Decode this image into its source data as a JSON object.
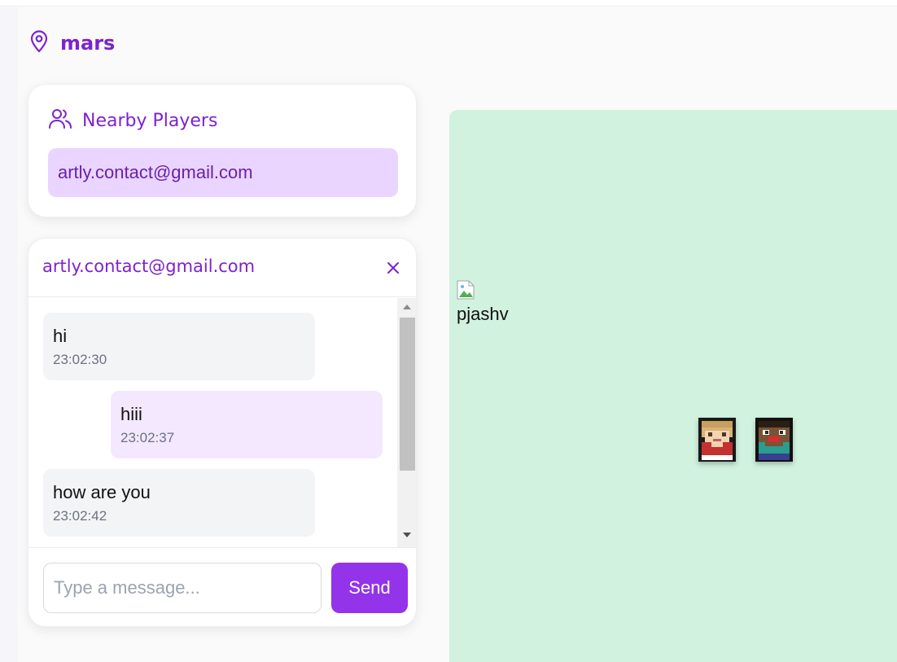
{
  "location": {
    "label": "mars",
    "icon": "map-pin-icon"
  },
  "nearby": {
    "title": "Nearby Players",
    "icon": "users-icon",
    "players": [
      {
        "email": "artly.contact@gmail.com"
      }
    ]
  },
  "chat": {
    "title": "artly.contact@gmail.com",
    "close_icon": "close-icon",
    "messages": [
      {
        "text": "hi",
        "time": "23:02:30",
        "direction": "incoming"
      },
      {
        "text": "hiii",
        "time": "23:02:37",
        "direction": "outgoing"
      },
      {
        "text": "how are you",
        "time": "23:02:42",
        "direction": "incoming"
      }
    ],
    "input_placeholder": "Type a message...",
    "send_label": "Send"
  },
  "map": {
    "background_color": "#d1f2de",
    "broken_image_alt": "pjashv",
    "avatars": [
      {
        "icon": "blonde-player-sprite-icon"
      },
      {
        "icon": "dark-player-sprite-icon"
      }
    ]
  },
  "colors": {
    "accent": "#9333ea",
    "accent_text": "#7e22ce",
    "player_highlight": "#e9d5ff",
    "outgoing_bubble": "#f3e8ff",
    "incoming_bubble": "#f3f4f6"
  }
}
